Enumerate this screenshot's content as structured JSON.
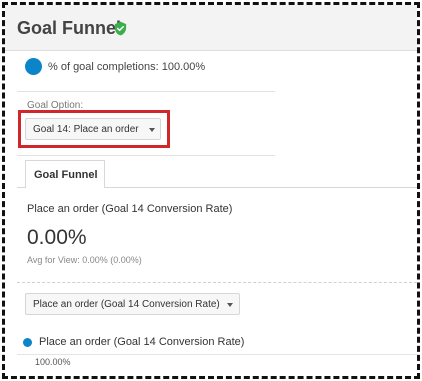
{
  "header": {
    "title": "Goal Funnel",
    "icon": "verified-shield-check-icon",
    "icon_color": "#3cae4b"
  },
  "summary": {
    "legend_text": "% of goal completions: 100.00%",
    "dot_color": "#0b84c8"
  },
  "goal_option": {
    "label": "Goal Option:",
    "selected": "Goal 14: Place an order",
    "highlight_color": "#d0282a"
  },
  "tabs": [
    {
      "label": "Goal Funnel",
      "active": true
    }
  ],
  "metric": {
    "title": "Place an order (Goal 14 Conversion Rate)",
    "value": "0.00%",
    "avg": "Avg for View: 0.00% (0.00%)"
  },
  "metric_select": {
    "selected": "Place an order (Goal 14 Conversion Rate)"
  },
  "series": {
    "label": "Place an order (Goal 14 Conversion Rate)",
    "value": "100.00%",
    "color": "#0b84c8"
  }
}
